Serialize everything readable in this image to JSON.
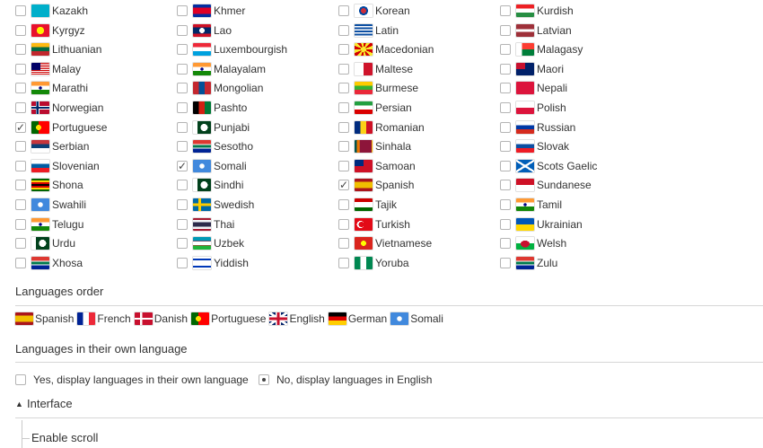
{
  "languages": [
    {
      "name": "Kazakh",
      "checked": false,
      "flag": "kazakhstan"
    },
    {
      "name": "Khmer",
      "checked": false,
      "flag": "cambodia"
    },
    {
      "name": "Korean",
      "checked": false,
      "flag": "south-korea"
    },
    {
      "name": "Kurdish",
      "checked": false,
      "flag": "kurdistan"
    },
    {
      "name": "Kyrgyz",
      "checked": false,
      "flag": "kyrgyzstan"
    },
    {
      "name": "Lao",
      "checked": false,
      "flag": "laos"
    },
    {
      "name": "Latin",
      "checked": false,
      "flag": "latin"
    },
    {
      "name": "Latvian",
      "checked": false,
      "flag": "latvia"
    },
    {
      "name": "Lithuanian",
      "checked": false,
      "flag": "lithuania"
    },
    {
      "name": "Luxembourgish",
      "checked": false,
      "flag": "luxembourg"
    },
    {
      "name": "Macedonian",
      "checked": false,
      "flag": "macedonia"
    },
    {
      "name": "Malagasy",
      "checked": false,
      "flag": "madagascar"
    },
    {
      "name": "Malay",
      "checked": false,
      "flag": "malaysia"
    },
    {
      "name": "Malayalam",
      "checked": false,
      "flag": "india"
    },
    {
      "name": "Maltese",
      "checked": false,
      "flag": "malta"
    },
    {
      "name": "Maori",
      "checked": false,
      "flag": "new-zealand"
    },
    {
      "name": "Marathi",
      "checked": false,
      "flag": "india"
    },
    {
      "name": "Mongolian",
      "checked": false,
      "flag": "mongolia"
    },
    {
      "name": "Burmese",
      "checked": false,
      "flag": "myanmar"
    },
    {
      "name": "Nepali",
      "checked": false,
      "flag": "nepal"
    },
    {
      "name": "Norwegian",
      "checked": false,
      "flag": "norway"
    },
    {
      "name": "Pashto",
      "checked": false,
      "flag": "afghanistan"
    },
    {
      "name": "Persian",
      "checked": false,
      "flag": "iran"
    },
    {
      "name": "Polish",
      "checked": false,
      "flag": "poland"
    },
    {
      "name": "Portuguese",
      "checked": true,
      "flag": "portugal"
    },
    {
      "name": "Punjabi",
      "checked": false,
      "flag": "pakistan"
    },
    {
      "name": "Romanian",
      "checked": false,
      "flag": "romania"
    },
    {
      "name": "Russian",
      "checked": false,
      "flag": "russia"
    },
    {
      "name": "Serbian",
      "checked": false,
      "flag": "serbia"
    },
    {
      "name": "Sesotho",
      "checked": false,
      "flag": "south-africa"
    },
    {
      "name": "Sinhala",
      "checked": false,
      "flag": "sri-lanka"
    },
    {
      "name": "Slovak",
      "checked": false,
      "flag": "slovakia"
    },
    {
      "name": "Slovenian",
      "checked": false,
      "flag": "slovenia"
    },
    {
      "name": "Somali",
      "checked": true,
      "flag": "somalia"
    },
    {
      "name": "Samoan",
      "checked": false,
      "flag": "samoa"
    },
    {
      "name": "Scots Gaelic",
      "checked": false,
      "flag": "scotland"
    },
    {
      "name": "Shona",
      "checked": false,
      "flag": "zimbabwe"
    },
    {
      "name": "Sindhi",
      "checked": false,
      "flag": "pakistan"
    },
    {
      "name": "Spanish",
      "checked": true,
      "flag": "spain"
    },
    {
      "name": "Sundanese",
      "checked": false,
      "flag": "indonesia"
    },
    {
      "name": "Swahili",
      "checked": false,
      "flag": "somalia"
    },
    {
      "name": "Swedish",
      "checked": false,
      "flag": "sweden"
    },
    {
      "name": "Tajik",
      "checked": false,
      "flag": "tajikistan"
    },
    {
      "name": "Tamil",
      "checked": false,
      "flag": "india"
    },
    {
      "name": "Telugu",
      "checked": false,
      "flag": "india"
    },
    {
      "name": "Thai",
      "checked": false,
      "flag": "thailand"
    },
    {
      "name": "Turkish",
      "checked": false,
      "flag": "turkey"
    },
    {
      "name": "Ukrainian",
      "checked": false,
      "flag": "ukraine"
    },
    {
      "name": "Urdu",
      "checked": false,
      "flag": "pakistan"
    },
    {
      "name": "Uzbek",
      "checked": false,
      "flag": "uzbekistan"
    },
    {
      "name": "Vietnamese",
      "checked": false,
      "flag": "vietnam"
    },
    {
      "name": "Welsh",
      "checked": false,
      "flag": "wales"
    },
    {
      "name": "Xhosa",
      "checked": false,
      "flag": "south-africa"
    },
    {
      "name": "Yiddish",
      "checked": false,
      "flag": "israel"
    },
    {
      "name": "Yoruba",
      "checked": false,
      "flag": "nigeria"
    },
    {
      "name": "Zulu",
      "checked": false,
      "flag": "south-africa"
    }
  ],
  "languages_order": {
    "heading": "Languages order",
    "items": [
      {
        "name": "Spanish",
        "flag": "spain"
      },
      {
        "name": "French",
        "flag": "france"
      },
      {
        "name": "Danish",
        "flag": "denmark"
      },
      {
        "name": "Portuguese",
        "flag": "portugal"
      },
      {
        "name": "English",
        "flag": "uk"
      },
      {
        "name": "German",
        "flag": "germany"
      },
      {
        "name": "Somali",
        "flag": "somalia"
      }
    ]
  },
  "own_language": {
    "heading": "Languages in their own language",
    "option_yes": "Yes, display languages in their own language",
    "option_no": "No, display languages in English",
    "selected": "no"
  },
  "interface": {
    "label": "Interface",
    "expanded": true,
    "enable_scroll": "Enable scroll"
  }
}
